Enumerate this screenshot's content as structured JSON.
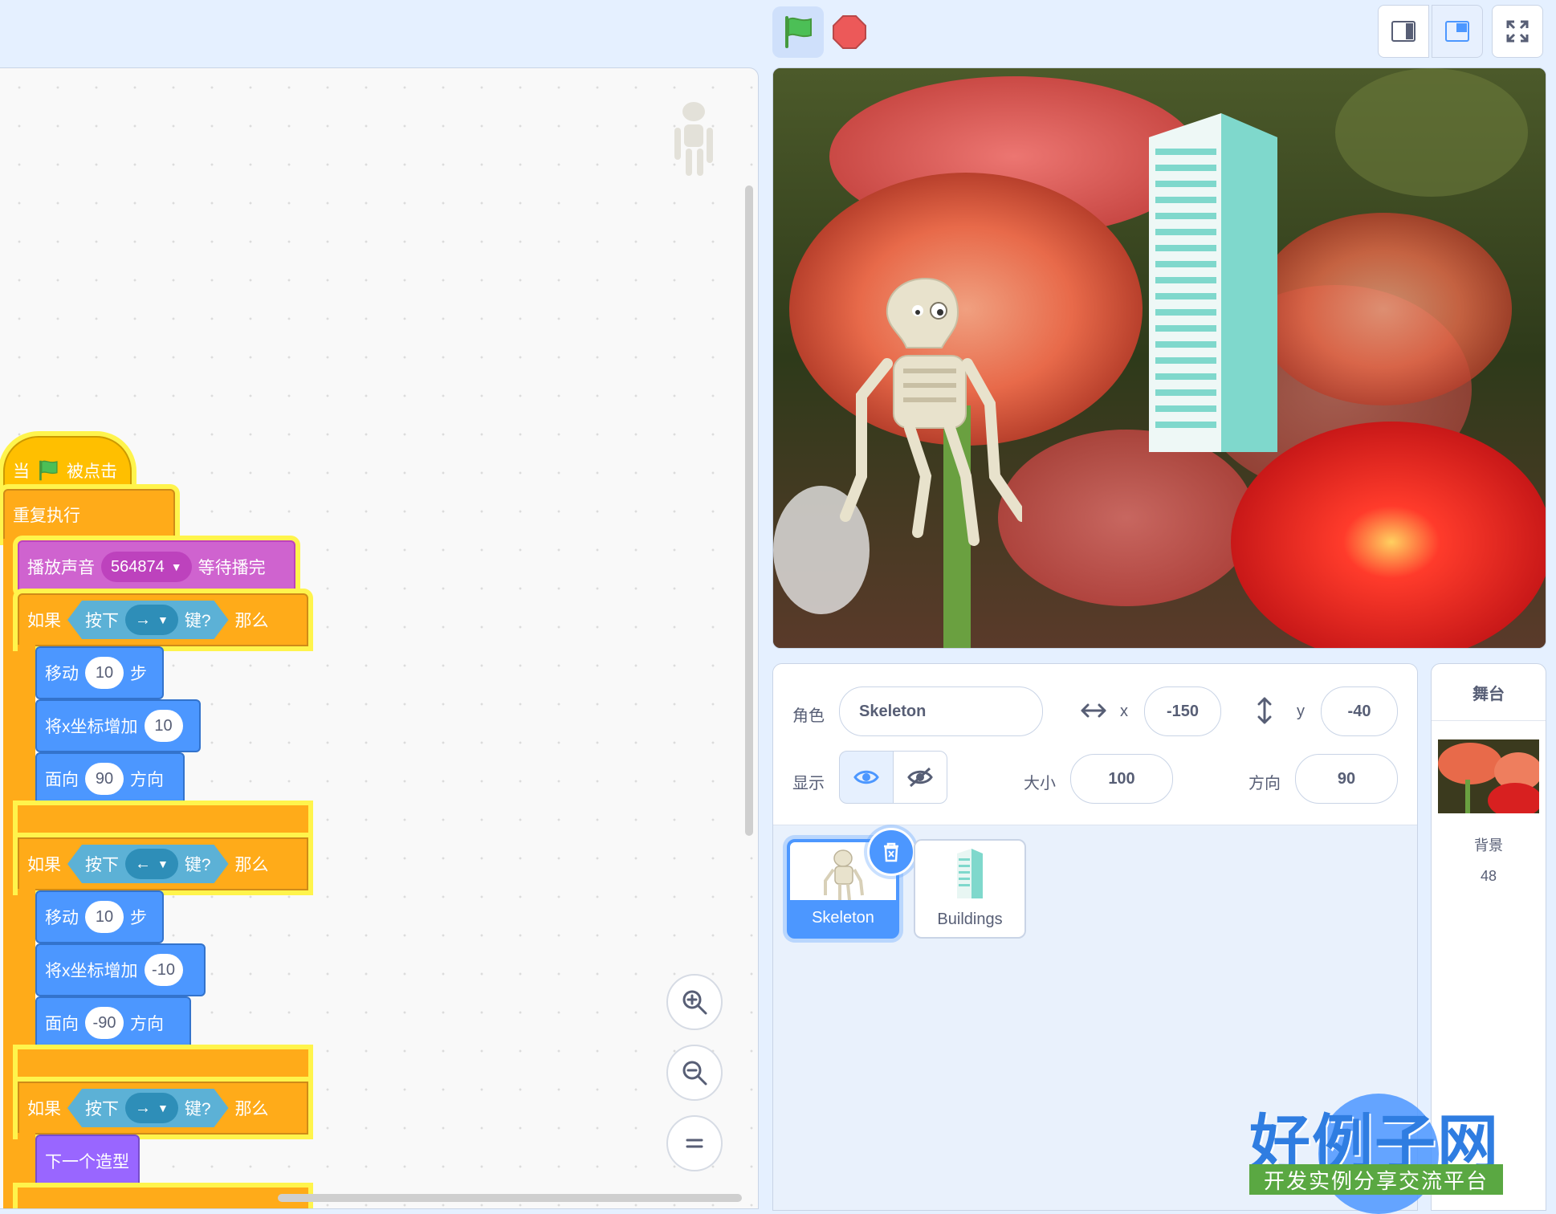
{
  "toolbar": {
    "green_flag": "green-flag",
    "stop": "stop-sign"
  },
  "script": {
    "hat": {
      "prefix": "当",
      "suffix": "被点击"
    },
    "forever": "重复执行",
    "play_sound": {
      "label": "播放声音",
      "sound": "564874",
      "suffix": "等待播完"
    },
    "if1": {
      "if": "如果",
      "key_label": "按下",
      "key": "→",
      "key_suffix": "键?",
      "then": "那么"
    },
    "move1": {
      "label": "移动",
      "value": "10",
      "suffix": "步"
    },
    "changex1": {
      "label": "将x坐标增加",
      "value": "10"
    },
    "point1": {
      "label": "面向",
      "value": "90",
      "suffix": "方向"
    },
    "if2": {
      "if": "如果",
      "key_label": "按下",
      "key": "←",
      "key_suffix": "键?",
      "then": "那么"
    },
    "move2": {
      "label": "移动",
      "value": "10",
      "suffix": "步"
    },
    "changex2": {
      "label": "将x坐标增加",
      "value": "-10"
    },
    "point2": {
      "label": "面向",
      "value": "-90",
      "suffix": "方向"
    },
    "if3": {
      "if": "如果",
      "key_label": "按下",
      "key": "→",
      "key_suffix": "键?",
      "then": "那么"
    },
    "next_costume": "下一个造型"
  },
  "sprite_info": {
    "sprite_label": "角色",
    "sprite_name": "Skeleton",
    "x_label": "x",
    "x": "-150",
    "y_label": "y",
    "y": "-40",
    "show_label": "显示",
    "size_label": "大小",
    "size": "100",
    "direction_label": "方向",
    "direction": "90"
  },
  "sprites": [
    {
      "name": "Skeleton",
      "selected": true
    },
    {
      "name": "Buildings",
      "selected": false
    }
  ],
  "stage_panel": {
    "title": "舞台",
    "backdrop_label": "背景",
    "backdrop_count": "48"
  },
  "watermark": {
    "title": "好例子网",
    "subtitle": "开发实例分享交流平台"
  },
  "colors": {
    "events": "#ffbf00",
    "control": "#ffab19",
    "sound": "#cf63cf",
    "motion": "#4c97ff",
    "sensing": "#5cb1d6",
    "looks": "#9966ff",
    "highlight": "#fff44c"
  }
}
